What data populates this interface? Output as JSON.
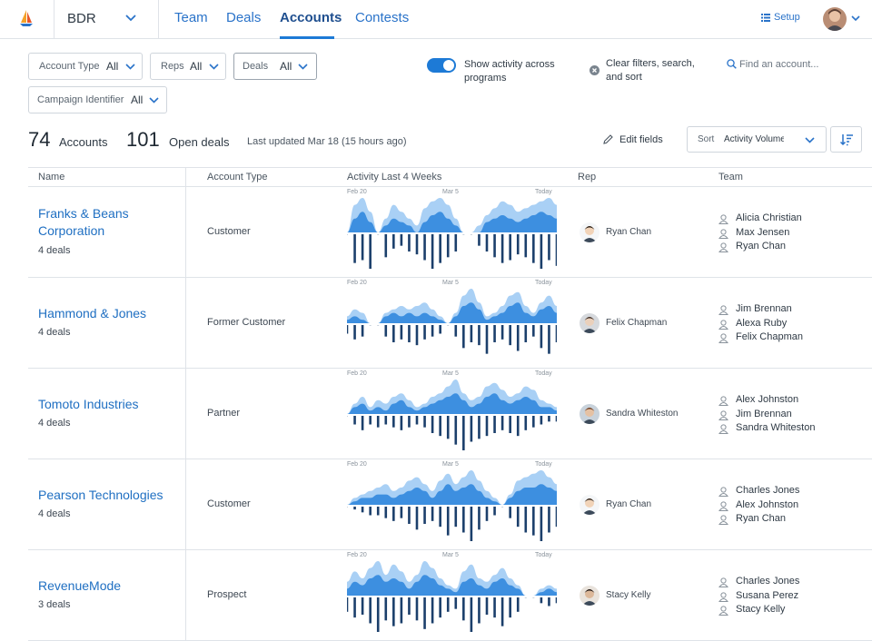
{
  "nav": {
    "workspace": "BDR",
    "tabs": [
      "Team",
      "Deals",
      "Accounts",
      "Contests"
    ],
    "setup": "Setup"
  },
  "filters": {
    "account_type": {
      "label": "Account Type",
      "value": "All"
    },
    "reps": {
      "label": "Reps",
      "value": "All"
    },
    "deals": {
      "label": "Deals",
      "value": "All"
    },
    "campaign": {
      "label": "Campaign Identifier",
      "value": "All"
    },
    "show_activity": "Show activity across programs",
    "clear": "Clear filters, search, and sort",
    "find_placeholder": "Find an account..."
  },
  "summary": {
    "accounts_count": "74",
    "accounts_label": "Accounts",
    "deals_count": "101",
    "deals_label": "Open deals",
    "updated": "Last updated Mar 18 (15 hours ago)",
    "edit_fields": "Edit fields",
    "sort_label": "Sort",
    "sort_value": "Activity Volume"
  },
  "table": {
    "headers": [
      "Name",
      "Account Type",
      "Activity Last 4 Weeks",
      "Rep",
      "Team"
    ],
    "date_labels": [
      "Feb 20",
      "Mar 5",
      "Today"
    ],
    "rows": [
      {
        "name": "Franks & Beans Corporation",
        "deals": "4 deals",
        "type": "Customer",
        "rep": "Ryan Chan",
        "team": [
          "Alicia Christian",
          "Max Jensen",
          "Ryan Chan"
        ],
        "activity": {
          "light": [
            0,
            8,
            10,
            6,
            0,
            4,
            8,
            6,
            4,
            2,
            7,
            9,
            10,
            8,
            4,
            0,
            0,
            2,
            5,
            7,
            9,
            8,
            6,
            7,
            8,
            9,
            10,
            8
          ],
          "dark": [
            0,
            4,
            6,
            3,
            0,
            2,
            4,
            3,
            2,
            0,
            3,
            5,
            6,
            4,
            2,
            0,
            0,
            0,
            3,
            4,
            5,
            4,
            3,
            4,
            5,
            6,
            5,
            4
          ],
          "bars": [
            0,
            10,
            9,
            12,
            0,
            8,
            5,
            4,
            6,
            7,
            9,
            12,
            10,
            8,
            6,
            0,
            0,
            4,
            6,
            8,
            10,
            9,
            7,
            8,
            10,
            12,
            9,
            11
          ]
        }
      },
      {
        "name": "Hammond & Jones",
        "deals": "4 deals",
        "type": "Former Customer",
        "rep": "Felix Chapman",
        "team": [
          "Jim Brennan",
          "Alexa Ruby",
          "Felix Chapman"
        ],
        "activity": {
          "light": [
            2,
            4,
            3,
            0,
            0,
            3,
            4,
            5,
            4,
            5,
            6,
            4,
            2,
            0,
            3,
            8,
            10,
            6,
            2,
            3,
            5,
            8,
            9,
            5,
            3,
            6,
            8,
            5
          ],
          "dark": [
            1,
            2,
            1,
            0,
            0,
            2,
            3,
            2,
            3,
            2,
            3,
            2,
            1,
            0,
            2,
            5,
            6,
            4,
            1,
            2,
            3,
            5,
            6,
            3,
            2,
            4,
            5,
            3
          ],
          "bars": [
            3,
            5,
            4,
            0,
            0,
            4,
            6,
            5,
            6,
            7,
            5,
            4,
            3,
            0,
            4,
            8,
            6,
            7,
            10,
            6,
            5,
            7,
            9,
            6,
            4,
            8,
            10,
            6
          ]
        }
      },
      {
        "name": "Tomoto Industries",
        "deals": "4 deals",
        "type": "Partner",
        "rep": "Sandra Whiteston",
        "team": [
          "Alex Johnston",
          "Jim Brennan",
          "Sandra Whiteston"
        ],
        "activity": {
          "light": [
            0,
            3,
            5,
            2,
            4,
            3,
            5,
            6,
            4,
            2,
            3,
            5,
            6,
            8,
            10,
            6,
            4,
            5,
            8,
            9,
            7,
            5,
            6,
            8,
            7,
            4,
            3,
            2
          ],
          "dark": [
            0,
            2,
            3,
            1,
            2,
            1,
            3,
            4,
            2,
            1,
            2,
            3,
            4,
            5,
            6,
            4,
            2,
            3,
            5,
            6,
            4,
            3,
            4,
            5,
            4,
            2,
            2,
            1
          ],
          "bars": [
            0,
            3,
            5,
            3,
            4,
            3,
            4,
            5,
            4,
            3,
            4,
            6,
            7,
            8,
            10,
            12,
            9,
            8,
            7,
            6,
            5,
            6,
            7,
            5,
            4,
            3,
            2,
            2
          ]
        }
      },
      {
        "name": "Pearson Technologies",
        "deals": "4 deals",
        "type": "Customer",
        "rep": "Ryan Chan",
        "team": [
          "Charles Jones",
          "Alex Johnston",
          "Ryan Chan"
        ],
        "activity": {
          "light": [
            0,
            2,
            3,
            4,
            5,
            6,
            4,
            5,
            7,
            8,
            6,
            4,
            7,
            9,
            6,
            8,
            10,
            7,
            4,
            2,
            0,
            3,
            7,
            8,
            9,
            10,
            8,
            6
          ],
          "dark": [
            0,
            1,
            2,
            2,
            3,
            3,
            2,
            3,
            4,
            5,
            4,
            2,
            4,
            6,
            4,
            5,
            6,
            4,
            2,
            1,
            0,
            2,
            4,
            5,
            5,
            6,
            5,
            4
          ],
          "bars": [
            0,
            1,
            2,
            3,
            3,
            4,
            5,
            4,
            6,
            8,
            6,
            5,
            7,
            10,
            7,
            9,
            12,
            8,
            5,
            3,
            0,
            4,
            7,
            9,
            10,
            12,
            9,
            7
          ]
        }
      },
      {
        "name": "RevenueMode",
        "deals": "3 deals",
        "type": "Prospect",
        "rep": "Stacy Kelly",
        "team": [
          "Charles Jones",
          "Susana Perez",
          "Stacy Kelly"
        ],
        "activity": {
          "light": [
            4,
            7,
            5,
            8,
            10,
            6,
            9,
            7,
            4,
            6,
            10,
            8,
            5,
            3,
            2,
            7,
            9,
            5,
            4,
            6,
            8,
            5,
            3,
            0,
            0,
            2,
            3,
            2
          ],
          "dark": [
            2,
            4,
            3,
            5,
            6,
            4,
            5,
            4,
            2,
            4,
            6,
            5,
            3,
            2,
            1,
            4,
            5,
            3,
            2,
            4,
            5,
            3,
            2,
            0,
            0,
            1,
            2,
            1
          ],
          "bars": [
            5,
            7,
            6,
            9,
            12,
            8,
            10,
            9,
            6,
            8,
            11,
            9,
            7,
            5,
            4,
            8,
            12,
            9,
            6,
            7,
            10,
            7,
            5,
            0,
            0,
            2,
            3,
            2
          ]
        }
      }
    ]
  },
  "colors": {
    "accent": "#1d7ad6",
    "link": "#1f6fc2",
    "area_light": "#a9d0f5",
    "area_dark": "#3d8fe0",
    "bar": "#1b3f6b"
  }
}
